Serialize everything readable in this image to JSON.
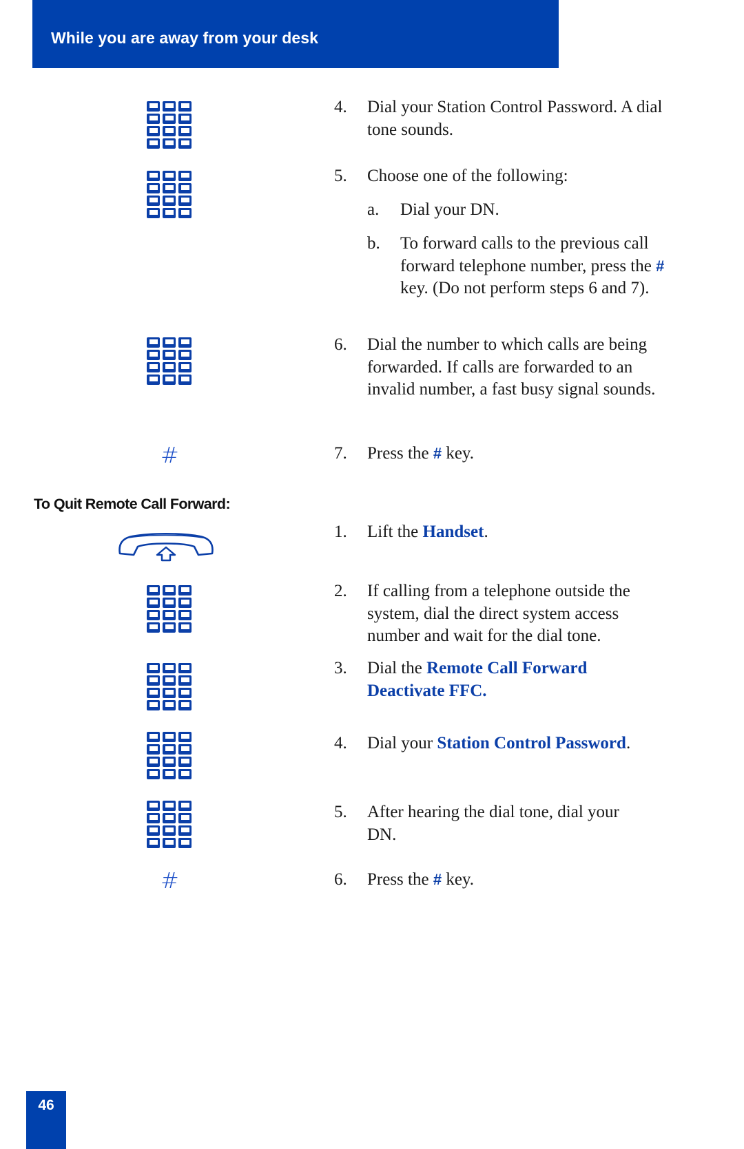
{
  "header": {
    "title": "While you are away from your desk"
  },
  "icons": {
    "keypad": "keypad-icon",
    "hash": "#",
    "handset": "handset-lift-icon"
  },
  "part1": {
    "steps": [
      {
        "number": "4.",
        "text": "Dial your Station Control Password. A dial tone sounds."
      },
      {
        "number": "5.",
        "text": "Choose one of the following:",
        "options": [
          {
            "letter": "a.",
            "text": "Dial your DN."
          },
          {
            "letter": "b.",
            "text_before": "To forward calls to the previous call forward telephone number, press the ",
            "key": "#",
            "text_after": " key. (Do not perform steps 6 and 7)."
          }
        ]
      },
      {
        "number": "6.",
        "text": "Dial the number to which calls are being forwarded. If calls are forwarded to an invalid number, a fast busy signal sounds."
      },
      {
        "number": "7.",
        "text_before": "Press the ",
        "key": "#",
        "text_after": " key."
      }
    ]
  },
  "quit_section": {
    "heading": "To Quit Remote Call Forward:",
    "steps": [
      {
        "number": "1.",
        "text_before": "Lift the ",
        "emphasis": "Handset",
        "text_after": "."
      },
      {
        "number": "2.",
        "text": "If calling from a telephone outside the system, dial the direct system access number and wait for the dial tone."
      },
      {
        "number": "3.",
        "text_before": "Dial the ",
        "emphasis": "Remote Call Forward Deactivate FFC.",
        "text_after": ""
      },
      {
        "number": "4.",
        "text_before": "Dial your ",
        "emphasis": "Station Control Password",
        "text_after": "."
      },
      {
        "number": "5.",
        "text": "After hearing the dial tone, dial your DN."
      },
      {
        "number": "6.",
        "text_before": "Press the ",
        "key": "#",
        "text_after": " key."
      }
    ]
  },
  "footer": {
    "page_number": "46"
  },
  "colors": {
    "brand_blue": "#0041ad",
    "emphasis_blue": "#0b3fa8"
  }
}
